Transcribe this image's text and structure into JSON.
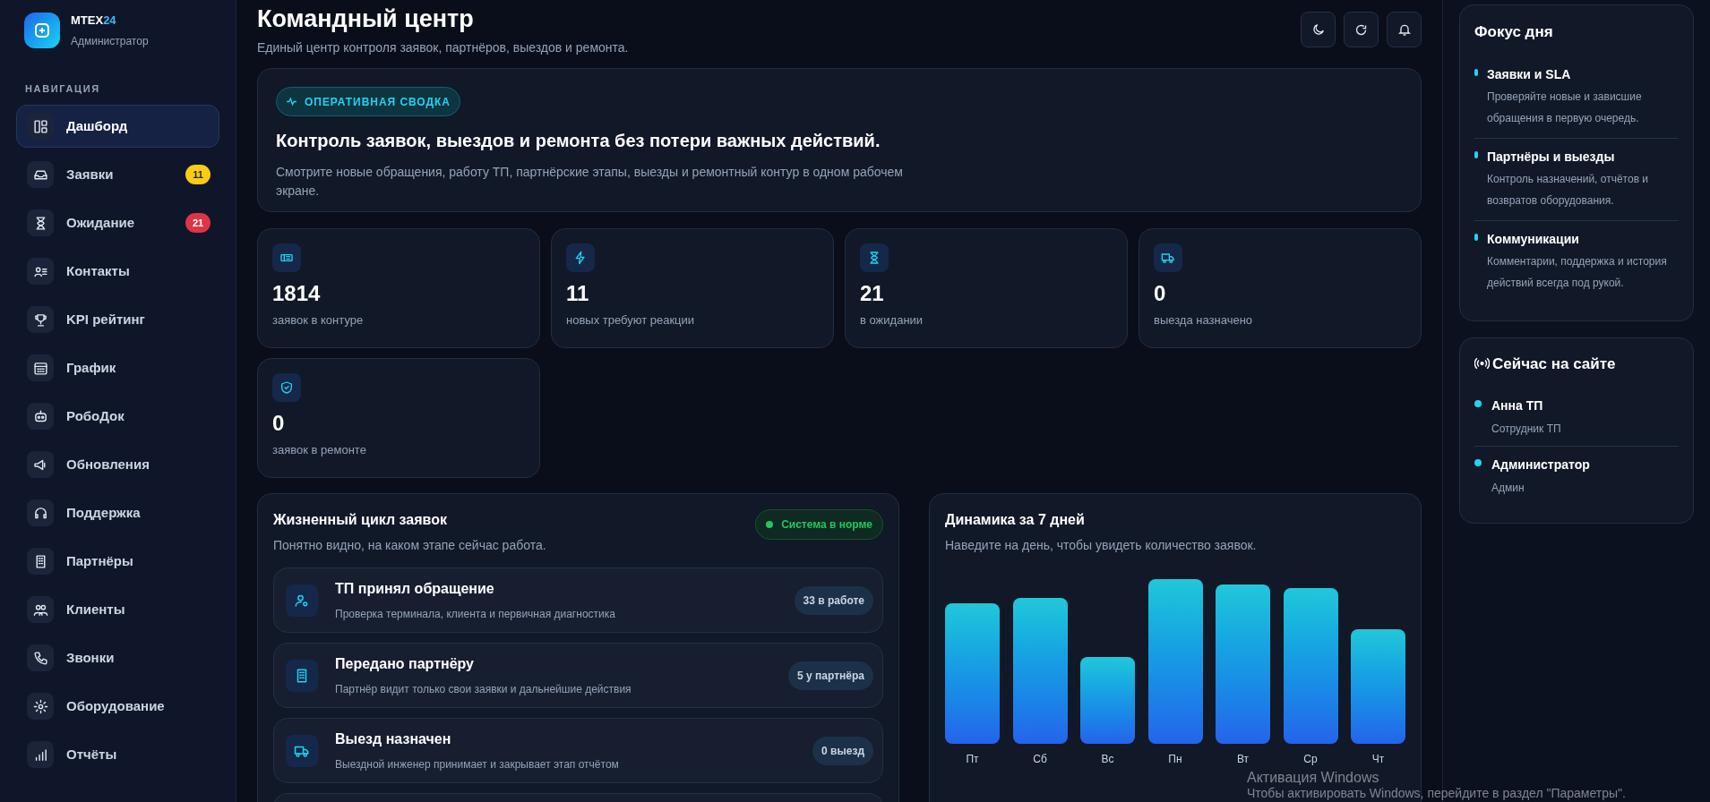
{
  "brand": {
    "name": "MTEX",
    "accent": "24",
    "role": "Администратор"
  },
  "sidebar": {
    "label": "НАВИГАЦИЯ",
    "items": [
      {
        "label": "Дашборд",
        "selected": true
      },
      {
        "label": "Заявки",
        "selected": false,
        "badge": {
          "text": "11",
          "color": "#facc15"
        }
      },
      {
        "label": "Ожидание",
        "selected": false,
        "badge": {
          "text": "21",
          "color": "#dc3545"
        }
      },
      {
        "label": "Контакты",
        "selected": false
      },
      {
        "label": "KPI рейтинг",
        "selected": false
      },
      {
        "label": "График",
        "selected": false
      },
      {
        "label": "РобоДок",
        "selected": false
      },
      {
        "label": "Обновления",
        "selected": false
      },
      {
        "label": "Поддержка",
        "selected": false
      },
      {
        "label": "Партнёры",
        "selected": false
      },
      {
        "label": "Клиенты",
        "selected": false
      },
      {
        "label": "Звонки",
        "selected": false
      },
      {
        "label": "Оборудование",
        "selected": false
      },
      {
        "label": "Отчёты",
        "selected": false
      }
    ]
  },
  "header": {
    "title": "Командный центр",
    "subtitle": "Единый центр контроля заявок, партнёров, выездов и ремонта."
  },
  "hero": {
    "tag": "ОПЕРАТИВНАЯ СВОДКА",
    "title": "Контроль заявок, выездов и ремонта без потери важных действий.",
    "text": "Смотрите новые обращения, работу ТП, партнёрские этапы, выезды и ремонтный контур в одном рабочем экране."
  },
  "stats": [
    {
      "value": "1814",
      "label": "заявок в контуре"
    },
    {
      "value": "11",
      "label": "новых требуют реакции"
    },
    {
      "value": "21",
      "label": "в ожидании"
    },
    {
      "value": "0",
      "label": "выезда назначено"
    },
    {
      "value": "0",
      "label": "заявок в ремонте"
    }
  ],
  "lifecycle": {
    "title": "Жизненный цикл заявок",
    "subtitle": "Понятно видно, на каком этапе сейчас работа.",
    "status": "Система в норме",
    "stages": [
      {
        "title": "ТП принял обращение",
        "text": "Проверка терминала, клиента и первичная диагностика",
        "badge": "33 в работе"
      },
      {
        "title": "Передано партнёру",
        "text": "Партнёр видит только свои заявки и дальнейшие действия",
        "badge": "5 у партнёра"
      },
      {
        "title": "Выезд назначен",
        "text": "Выездной инженер принимает и закрывает этап отчётом",
        "badge": "0 выезд"
      }
    ]
  },
  "dynamics": {
    "title": "Динамика за 7 дней",
    "subtitle": "Наведите на день, чтобы увидеть количество заявок.",
    "days": [
      "Пт",
      "Сб",
      "Вс",
      "Пн",
      "Вт",
      "Ср",
      "Чт"
    ]
  },
  "focus": {
    "title": "Фокус дня",
    "items": [
      {
        "title": "Заявки и SLA",
        "text": "Проверяйте новые и зависшие обращения в первую очередь."
      },
      {
        "title": "Партнёры и выезды",
        "text": "Контроль назначений, отчётов и возвратов оборудования."
      },
      {
        "title": "Коммуникации",
        "text": "Комментарии, поддержка и история действий всегда под рукой."
      }
    ]
  },
  "online": {
    "title": "Сейчас на сайте",
    "users": [
      {
        "name": "Анна ТП",
        "role": "Сотрудник ТП"
      },
      {
        "name": "Администратор",
        "role": "Админ"
      }
    ]
  },
  "os_notice": {
    "title": "Активация Windows",
    "text": "Чтобы активировать Windows, перейдите в раздел \"Параметры\"."
  }
}
